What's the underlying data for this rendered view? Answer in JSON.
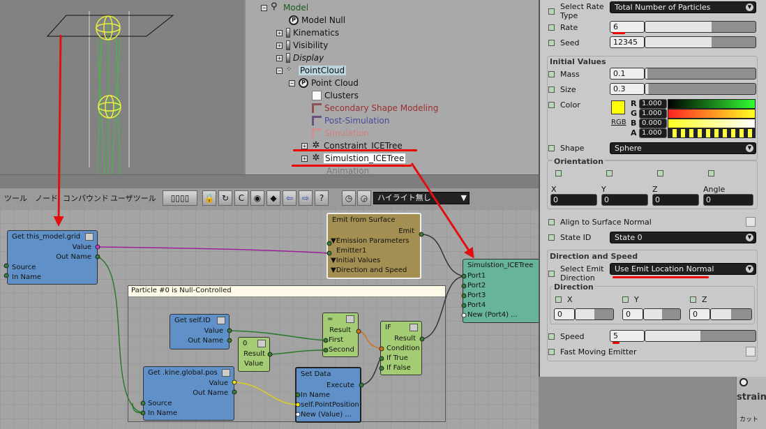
{
  "explorer": {
    "items": [
      {
        "label": "Model",
        "color": "#1a5a1a",
        "indent": 0
      },
      {
        "label": "Model Null",
        "indent": 1
      },
      {
        "label": "Kinematics",
        "indent": 1
      },
      {
        "label": "Visibility",
        "indent": 1
      },
      {
        "label": "Display",
        "indent": 1
      },
      {
        "label": "PointCloud",
        "indent": 1
      },
      {
        "label": "Point Cloud",
        "indent": 2
      },
      {
        "label": "Clusters",
        "indent": 3
      },
      {
        "label": "Secondary Shape Modeling",
        "indent": 3
      },
      {
        "label": "Post-Simulation",
        "indent": 3
      },
      {
        "label": "Simulation",
        "indent": 3
      },
      {
        "label": "Constraint_ICETree",
        "indent": 3
      },
      {
        "label": "Simulstion_ICETree",
        "indent": 3
      },
      {
        "label": "Animation",
        "indent": 3
      }
    ]
  },
  "ice_toolbar": {
    "menus": [
      "ツール",
      "ノード",
      "コンパウンド",
      "ユーザツール"
    ],
    "highlight_select": "ハイライト無し"
  },
  "nodes": {
    "get_grid": {
      "title": "Get this_model.grid",
      "out1": "Value",
      "out2": "Out Name",
      "in1": "Source",
      "in2": "In Name"
    },
    "emit": {
      "title": "Emit from Surface",
      "out": "Emit",
      "p1": "▼Emission Parameters",
      "p2": "Emitter1",
      "p3": "▼Initial Values",
      "p4": "▼Direction and Speed"
    },
    "sim": {
      "title": "Simulstion_ICETree",
      "ports": [
        "Port1",
        "Port2",
        "Port3",
        "Port4",
        "New (Port4) ..."
      ]
    },
    "frame": {
      "title": "Particle #0 is Null-Controlled"
    },
    "get_id": {
      "title": "Get self.ID",
      "out1": "Value",
      "out2": "Out Name"
    },
    "zero": {
      "title": "0",
      "out1": "Result",
      "out2": "Value"
    },
    "equal": {
      "title": "=",
      "out": "Result",
      "in1": "First",
      "in2": "Second"
    },
    "if": {
      "title": "IF",
      "out": "Result",
      "in1": "Condition",
      "in2": "If True",
      "in3": "If False"
    },
    "get_pos": {
      "title": "Get .kine.global.pos",
      "out1": "Value",
      "out2": "Out Name",
      "in1": "Source",
      "in2": "In Name"
    },
    "set_data": {
      "title": "Set Data",
      "out": "Execute",
      "in1": "In Name",
      "in2": "self.PointPosition",
      "in3": "New (Value) ..."
    }
  },
  "props": {
    "select_rate_label": "Select Rate",
    "select_rate_label2": "Type",
    "select_rate_value": "Total Number of Particles",
    "rate_label": "Rate",
    "rate_value": "6",
    "seed_label": "Seed",
    "seed_value": "12345",
    "initial_values_title": "Initial Values",
    "mass_label": "Mass",
    "mass_value": "0.1",
    "size_label": "Size",
    "size_value": "0.3",
    "color_label": "Color",
    "color_mode": "RGB",
    "color_swatch": "#ffff00",
    "channels": [
      {
        "name": "R",
        "value": "1.000"
      },
      {
        "name": "G",
        "value": "1.000"
      },
      {
        "name": "B",
        "value": "0.000"
      },
      {
        "name": "A",
        "value": "1.000"
      }
    ],
    "shape_label": "Shape",
    "shape_value": "Sphere",
    "orientation_title": "Orientation",
    "orient_fields": [
      {
        "label": "X",
        "value": "0"
      },
      {
        "label": "Y",
        "value": "0"
      },
      {
        "label": "Z",
        "value": "0"
      },
      {
        "label": "Angle",
        "value": "0"
      }
    ],
    "align_label": "Align to Surface Normal",
    "state_id_label": "State ID",
    "state_id_value": "State 0",
    "dir_speed_title": "Direction and Speed",
    "select_emit_label": "Select Emit",
    "select_emit_label2": "Direction",
    "select_emit_value": "Use Emit Location Normal",
    "direction_title": "Direction",
    "dir_fields": [
      {
        "label": "X",
        "value": "0"
      },
      {
        "label": "Y",
        "value": "0"
      },
      {
        "label": "Z",
        "value": "0"
      }
    ],
    "speed_label": "Speed",
    "speed_value": "5",
    "fast_label": "Fast Moving Emitter"
  },
  "bottom_right": {
    "label1": "strain",
    "label2": "カット"
  }
}
